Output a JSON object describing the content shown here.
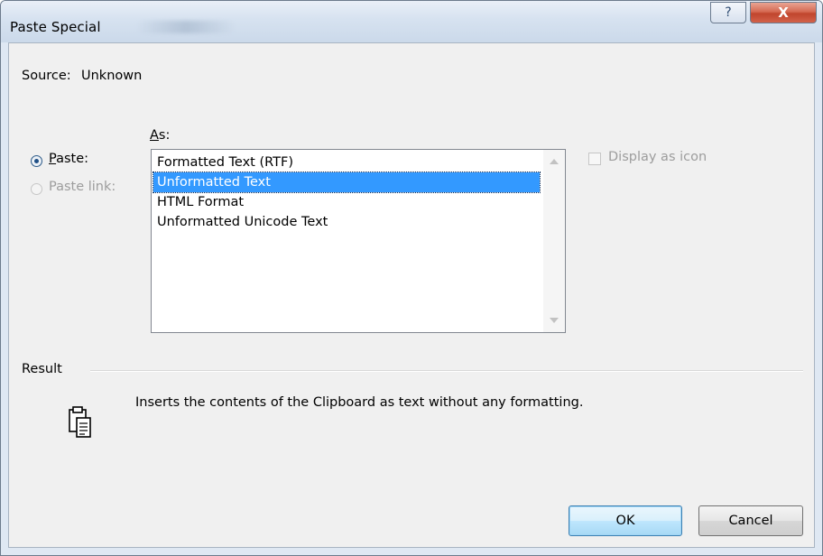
{
  "window": {
    "title": "Paste Special",
    "help_glyph": "?",
    "close_glyph": "X"
  },
  "source": {
    "label": "Source:",
    "value": "Unknown"
  },
  "as_label_accel": "A",
  "as_label_rest": "s:",
  "options": {
    "paste_accel": "P",
    "paste_rest": "aste:",
    "paste_checked": true,
    "paste_link_label": "Paste link:",
    "paste_link_enabled": false
  },
  "formats": [
    {
      "label": "Formatted Text (RTF)",
      "selected": false
    },
    {
      "label": "Unformatted Text",
      "selected": true
    },
    {
      "label": "HTML Format",
      "selected": false
    },
    {
      "label": "Unformatted Unicode Text",
      "selected": false
    }
  ],
  "display_as_icon": {
    "label": "Display as icon",
    "checked": false,
    "enabled": false
  },
  "result": {
    "heading": "Result",
    "description": "Inserts the contents of the Clipboard as text without any formatting.",
    "icon": "clipboard-paste-icon"
  },
  "buttons": {
    "ok": "OK",
    "cancel": "Cancel"
  },
  "colors": {
    "selection": "#3399ff",
    "close_button": "#c0452d",
    "disabled_text": "#9d9d9d"
  }
}
